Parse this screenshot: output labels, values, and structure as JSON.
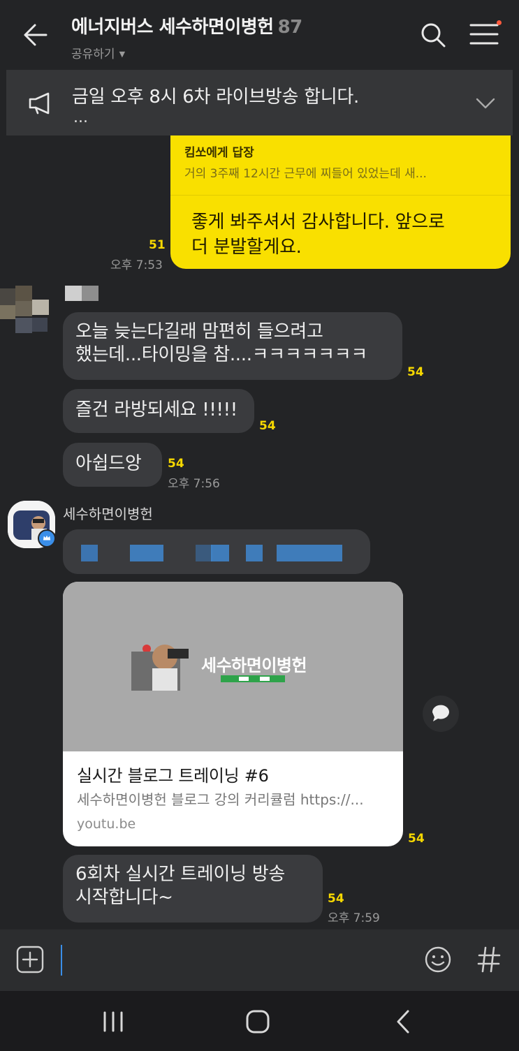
{
  "header": {
    "title": "에너지버스 세수하면이병헌",
    "member_count": "87",
    "share_label": "공유하기"
  },
  "notice": {
    "text": "금일 오후 8시 6차 라이브방송 합니다.",
    "more": "..."
  },
  "my_message": {
    "reply_to": "킴쏘에게 답장",
    "quote": "거의 3주째 12시간 근무에 찌들어 있었는데 새...",
    "line1": "좋게 봐주셔서 감사합니다. 앞으로",
    "line2": "더 분발할게요.",
    "unread": "51",
    "time": "오후 7:53"
  },
  "messages_a": [
    {
      "line1": "오늘 늦는다길래 맘편히 들으려고",
      "line2": "했는데...타이밍을 참....ㅋㅋㅋㅋㅋㅋㅋ",
      "unread": "54"
    },
    {
      "text": "즐건 라방되세요 !!!!!",
      "unread": "54"
    },
    {
      "text": "아쉽드앙",
      "unread": "54",
      "time": "오후 7:56"
    }
  ],
  "sender2": {
    "name": "세수하면이병헌"
  },
  "link_card": {
    "title": "실시간 블로그 트레이닝 #6",
    "description": "세수하면이병헌 블로그 강의 커리큘럼 https://...",
    "domain": "youtu.be",
    "thumb_heading": "세수하면이병헌",
    "unread": "54"
  },
  "last_message": {
    "line1": "6회차 실시간 트레이닝 방송",
    "line2": "시작합니다~",
    "unread": "54",
    "time": "오후 7:59"
  },
  "input": {
    "placeholder": ""
  },
  "colors": {
    "background": "#232426",
    "my_bubble": "#f9e000",
    "other_bubble": "#3a3b3e",
    "unread": "#f7d800",
    "accent": "#3a8ee8"
  },
  "icons": [
    "back-arrow-icon",
    "search-icon",
    "menu-icon",
    "megaphone-icon",
    "chevron-down-icon",
    "share-icon",
    "plus-icon",
    "emoji-icon",
    "hash-icon",
    "recents-icon",
    "home-icon",
    "nav-back-icon"
  ]
}
